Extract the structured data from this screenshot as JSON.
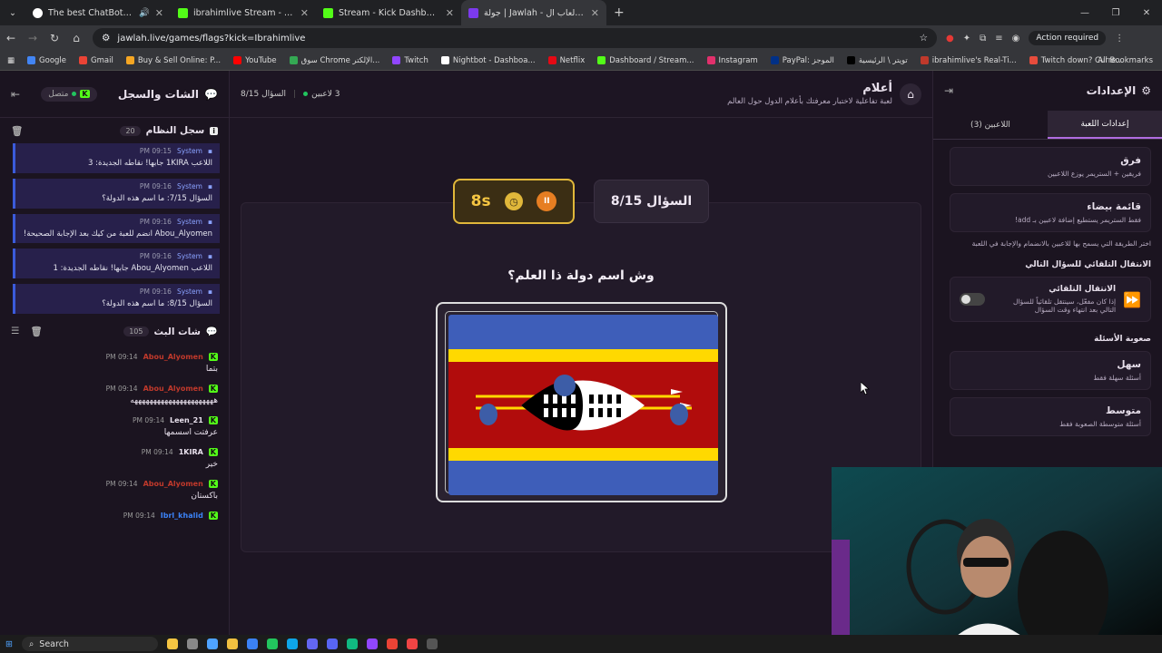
{
  "browser": {
    "tabs": [
      {
        "title": "The best ChatBot and Widg",
        "active": false,
        "favicon_color": "#ffffff"
      },
      {
        "title": "ibrahimlive Stream - Watch Live",
        "active": false,
        "favicon_color": "#53fc18"
      },
      {
        "title": "Stream - Kick Dashboard",
        "active": false,
        "favicon_color": "#53fc18"
      },
      {
        "title": "جولة | Jawlah - منصة الألعاب ال",
        "active": true,
        "favicon_color": "#7c3aed"
      }
    ],
    "url": "jawlah.live/games/flags?kick=Ibrahimlive",
    "action_required": "Action required",
    "bookmarks": [
      {
        "label": "Google",
        "color": "#4285f4"
      },
      {
        "label": "Gmail",
        "color": "#ea4335"
      },
      {
        "label": "Buy & Sell Online: P...",
        "color": "#f5a623"
      },
      {
        "label": "YouTube",
        "color": "#ff0000"
      },
      {
        "label": "سوق Chrome الإلكتر...",
        "color": "#34a853"
      },
      {
        "label": "Twitch",
        "color": "#9146ff"
      },
      {
        "label": "Nightbot - Dashboa...",
        "color": "#ffffff"
      },
      {
        "label": "Netflix",
        "color": "#e50914"
      },
      {
        "label": "Dashboard / Stream...",
        "color": "#53fc18"
      },
      {
        "label": "Instagram",
        "color": "#e1306c"
      },
      {
        "label": "PayPal: الموجز",
        "color": "#003087"
      },
      {
        "label": "تويتر \\ الرئيسية",
        "color": "#000000"
      },
      {
        "label": "ibrahimlive's Real-Ti...",
        "color": "#c0392b"
      },
      {
        "label": "Twitch down? Curre...",
        "color": "#e74c3c"
      }
    ],
    "all_bookmarks": "All Bookmarks"
  },
  "left_panel": {
    "title": "الشات والسجل",
    "status": "متصل",
    "system_log": {
      "title": "سجل النظام",
      "count": "20",
      "items": [
        {
          "author": "System",
          "time": "09:15 PM",
          "text": "اللاعب 1KIRA جابها! نقاطه الجديدة: 3"
        },
        {
          "author": "System",
          "time": "09:16 PM",
          "text": "السؤال 7/15: ما اسم هذه الدولة؟"
        },
        {
          "author": "System",
          "time": "09:16 PM",
          "text": "Abou_Alyomen انضم للعبة من كيك بعد الإجابة الصحيحة!"
        },
        {
          "author": "System",
          "time": "09:16 PM",
          "text": "اللاعب Abou_Alyomen جابها! نقاطه الجديدة: 1"
        },
        {
          "author": "System",
          "time": "09:16 PM",
          "text": "السؤال 8/15: ما اسم هذه الدولة؟"
        }
      ]
    },
    "stream_chat": {
      "title": "شات البث",
      "count": "105",
      "items": [
        {
          "user": "Abou_Alyomen",
          "time": "09:14 PM",
          "text": "بتما",
          "color": "#c0392b"
        },
        {
          "user": "Abou_Alyomen",
          "time": "09:14 PM",
          "text": "ههههههههههههههههههههههه",
          "color": "#c0392b"
        },
        {
          "user": "Leen_21",
          "time": "09:14 PM",
          "text": "عرفتت اسسمها",
          "color": "#e8e0ec"
        },
        {
          "user": "1KIRA",
          "time": "09:14 PM",
          "text": "خير",
          "color": "#e8e0ec"
        },
        {
          "user": "Abou_Alyomen",
          "time": "09:14 PM",
          "text": "باكستان",
          "color": "#c0392b"
        },
        {
          "user": "Ibrl_khalid",
          "time": "09:14 PM",
          "text": "",
          "color": "#3b82f6"
        }
      ]
    }
  },
  "game": {
    "title": "أعلام",
    "subtitle": "لعبة تفاعلية لاختبار معرفتك بأعلام الدول حول العالم",
    "players": "3 لاعبين",
    "question_counter": "السؤال 8/15",
    "timer": "8s",
    "question_label": "السؤال 8/15",
    "question_text": "وش اسم دولة ذا العلم؟"
  },
  "settings": {
    "title": "الإعدادات",
    "tabs": [
      {
        "label": "إعدادات اللعبة",
        "active": true
      },
      {
        "label": "اللاعبين (3)",
        "active": false
      }
    ],
    "join_modes": [
      {
        "title": "فرق",
        "desc": "فريقين + الستريمر يوزع اللاعبين"
      },
      {
        "title": "قائمة بيضاء",
        "desc": "فقط الستريمر يستطيع إضافة لاعبين بـ add!"
      }
    ],
    "join_note": "اختر الطريقة التي يسمح بها للاعبين بالانضمام والإجابة في اللعبة",
    "auto_next_section": "الانتقال التلقائي للسؤال التالي",
    "auto_next": {
      "title": "الانتقال التلقائي",
      "desc": "إذا كان مفعّل، سينتقل تلقائياً للسؤال التالي بعد انتهاء وقت السؤال",
      "enabled": false
    },
    "difficulty_section": "صعوبة الأسئلة",
    "difficulties": [
      {
        "title": "سهل",
        "desc": "أسئلة سهلة فقط"
      },
      {
        "title": "متوسط",
        "desc": "أسئلة متوسطة الصعوبة فقط"
      }
    ]
  },
  "taskbar": {
    "search": "Search"
  },
  "colors": {
    "flag_blue": "#3e5eb9",
    "flag_yellow": "#ffd900",
    "flag_red": "#b10c0c",
    "accent_purple": "#b06ce0",
    "timer_gold": "#e0b73a"
  }
}
